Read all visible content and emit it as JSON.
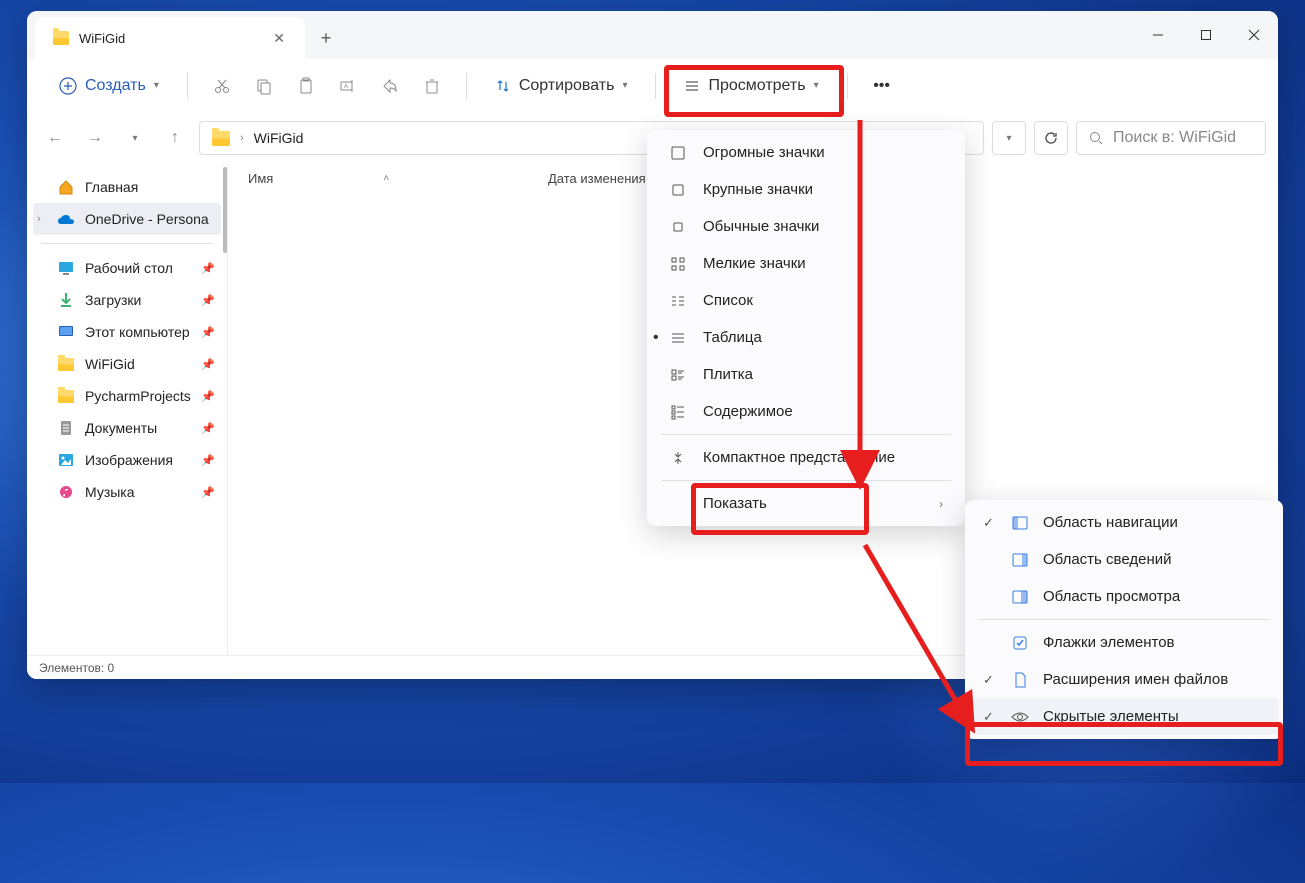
{
  "tab": {
    "title": "WiFiGid"
  },
  "toolbar": {
    "create": "Создать",
    "sort": "Сортировать",
    "view": "Просмотреть"
  },
  "address": {
    "path": "WiFiGid"
  },
  "search": {
    "placeholder": "Поиск в: WiFiGid"
  },
  "sidebar": {
    "home": "Главная",
    "onedrive": "OneDrive - Personal",
    "desktop": "Рабочий стол",
    "downloads": "Загрузки",
    "thispc": "Этот компьютер",
    "wifigid": "WiFiGid",
    "pycharm": "PycharmProjects",
    "documents": "Документы",
    "images": "Изображения",
    "music": "Музыка"
  },
  "columns": {
    "name": "Имя",
    "date": "Дата изменения"
  },
  "status": "Элементов: 0",
  "viewMenu": {
    "extraLarge": "Огромные значки",
    "large": "Крупные значки",
    "medium": "Обычные значки",
    "small": "Мелкие значки",
    "list": "Список",
    "details": "Таблица",
    "tiles": "Плитка",
    "content": "Содержимое",
    "compact": "Компактное представление",
    "show": "Показать"
  },
  "showMenu": {
    "navPane": "Область навигации",
    "detailsPane": "Область сведений",
    "previewPane": "Область просмотра",
    "itemCheck": "Флажки элементов",
    "extensions": "Расширения имен файлов",
    "hidden": "Скрытые элементы"
  }
}
